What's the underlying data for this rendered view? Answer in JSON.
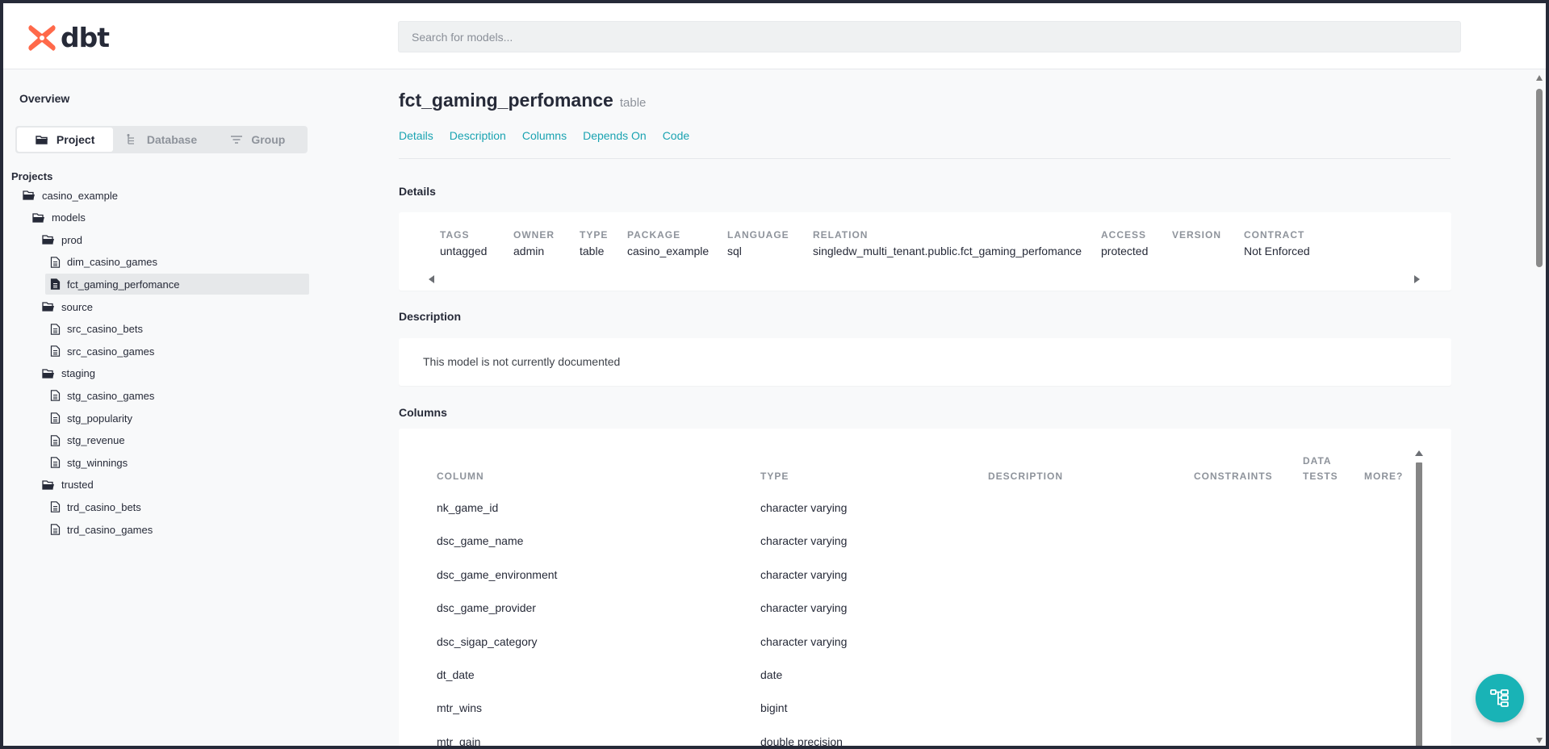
{
  "app": {
    "logo_text": "dbt",
    "brand_color": "#ff694a",
    "accent_color": "#1aa3b1"
  },
  "search": {
    "placeholder": "Search for models..."
  },
  "sidebar": {
    "overview": "Overview",
    "tabs": [
      {
        "label": "Project",
        "icon": "folder-icon",
        "active": true
      },
      {
        "label": "Database",
        "icon": "database-tree-icon",
        "active": false
      },
      {
        "label": "Group",
        "icon": "filter-lines-icon",
        "active": false
      }
    ],
    "projects_label": "Projects",
    "tree": [
      {
        "label": "casino_example",
        "type": "folder",
        "depth": 0
      },
      {
        "label": "models",
        "type": "folder",
        "depth": 1
      },
      {
        "label": "prod",
        "type": "folder",
        "depth": 2
      },
      {
        "label": "dim_casino_games",
        "type": "file",
        "depth": 3
      },
      {
        "label": "fct_gaming_perfomance",
        "type": "file",
        "depth": 3,
        "selected": true
      },
      {
        "label": "source",
        "type": "folder",
        "depth": 2
      },
      {
        "label": "src_casino_bets",
        "type": "file",
        "depth": 3
      },
      {
        "label": "src_casino_games",
        "type": "file",
        "depth": 3
      },
      {
        "label": "staging",
        "type": "folder",
        "depth": 2
      },
      {
        "label": "stg_casino_games",
        "type": "file",
        "depth": 3
      },
      {
        "label": "stg_popularity",
        "type": "file",
        "depth": 3
      },
      {
        "label": "stg_revenue",
        "type": "file",
        "depth": 3
      },
      {
        "label": "stg_winnings",
        "type": "file",
        "depth": 3
      },
      {
        "label": "trusted",
        "type": "folder",
        "depth": 2
      },
      {
        "label": "trd_casino_bets",
        "type": "file",
        "depth": 3
      },
      {
        "label": "trd_casino_games",
        "type": "file",
        "depth": 3
      }
    ]
  },
  "main": {
    "title": "fct_gaming_perfomance",
    "subtitle": "table",
    "nav": [
      "Details",
      "Description",
      "Columns",
      "Depends On",
      "Code"
    ],
    "details_title": "Details",
    "details": [
      {
        "head": "TAGS",
        "value": "untagged"
      },
      {
        "head": "OWNER",
        "value": "admin"
      },
      {
        "head": "TYPE",
        "value": "table"
      },
      {
        "head": "PACKAGE",
        "value": "casino_example"
      },
      {
        "head": "LANGUAGE",
        "value": "sql"
      },
      {
        "head": "RELATION",
        "value": "singledw_multi_tenant.public.fct_gaming_perfomance"
      },
      {
        "head": "ACCESS",
        "value": "protected"
      },
      {
        "head": "VERSION",
        "value": ""
      },
      {
        "head": "CONTRACT",
        "value": "Not Enforced"
      }
    ],
    "description_title": "Description",
    "description_text": "This model is not currently documented",
    "columns_title": "Columns",
    "column_headers": {
      "column": "COLUMN",
      "type": "TYPE",
      "description": "DESCRIPTION",
      "constraints": "CONSTRAINTS",
      "data_tests_1": "DATA",
      "data_tests_2": "TESTS",
      "more": "MORE?"
    },
    "columns": [
      {
        "name": "nk_game_id",
        "type": "character varying"
      },
      {
        "name": "dsc_game_name",
        "type": "character varying"
      },
      {
        "name": "dsc_game_environment",
        "type": "character varying"
      },
      {
        "name": "dsc_game_provider",
        "type": "character varying"
      },
      {
        "name": "dsc_sigap_category",
        "type": "character varying"
      },
      {
        "name": "dt_date",
        "type": "date"
      },
      {
        "name": "mtr_wins",
        "type": "bigint"
      },
      {
        "name": "mtr_gain",
        "type": "double precision"
      }
    ]
  },
  "fab": {
    "icon": "lineage-graph-icon"
  }
}
